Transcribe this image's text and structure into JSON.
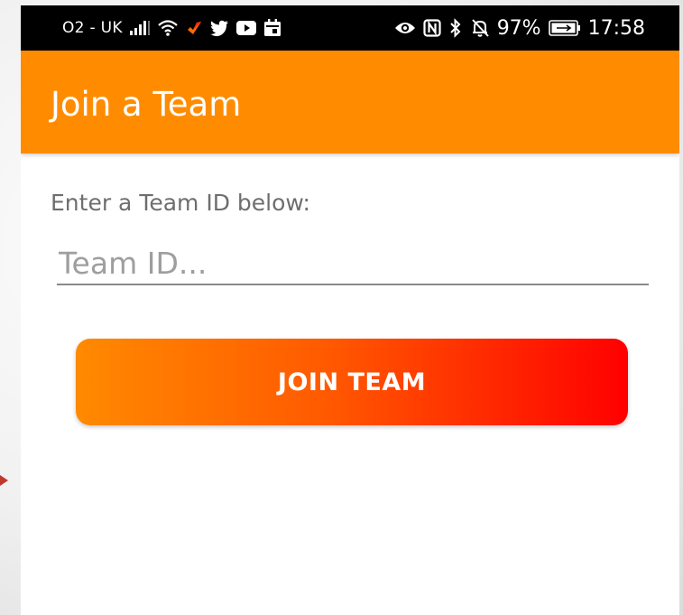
{
  "status_bar": {
    "carrier": "O2 - UK",
    "battery_percent": "97%",
    "time": "17:58",
    "left_icons": [
      "signal-icon",
      "wifi-icon",
      "brand-app-icon",
      "twitter-icon",
      "youtube-icon",
      "calendar-icon"
    ],
    "right_icons": [
      "eye-icon",
      "nfc-icon",
      "bluetooth-icon",
      "bell-muted-icon",
      "battery-icon"
    ]
  },
  "app_bar": {
    "title": "Join a Team",
    "color": "#ff8c00"
  },
  "form": {
    "prompt": "Enter a Team ID below:",
    "team_id_placeholder": "Team ID...",
    "team_id_value": "",
    "join_button_label": "JOIN TEAM"
  },
  "colors": {
    "button_gradient_start": "#ff8a00",
    "button_gradient_end": "#ff0000",
    "status_bar": "#000000"
  }
}
